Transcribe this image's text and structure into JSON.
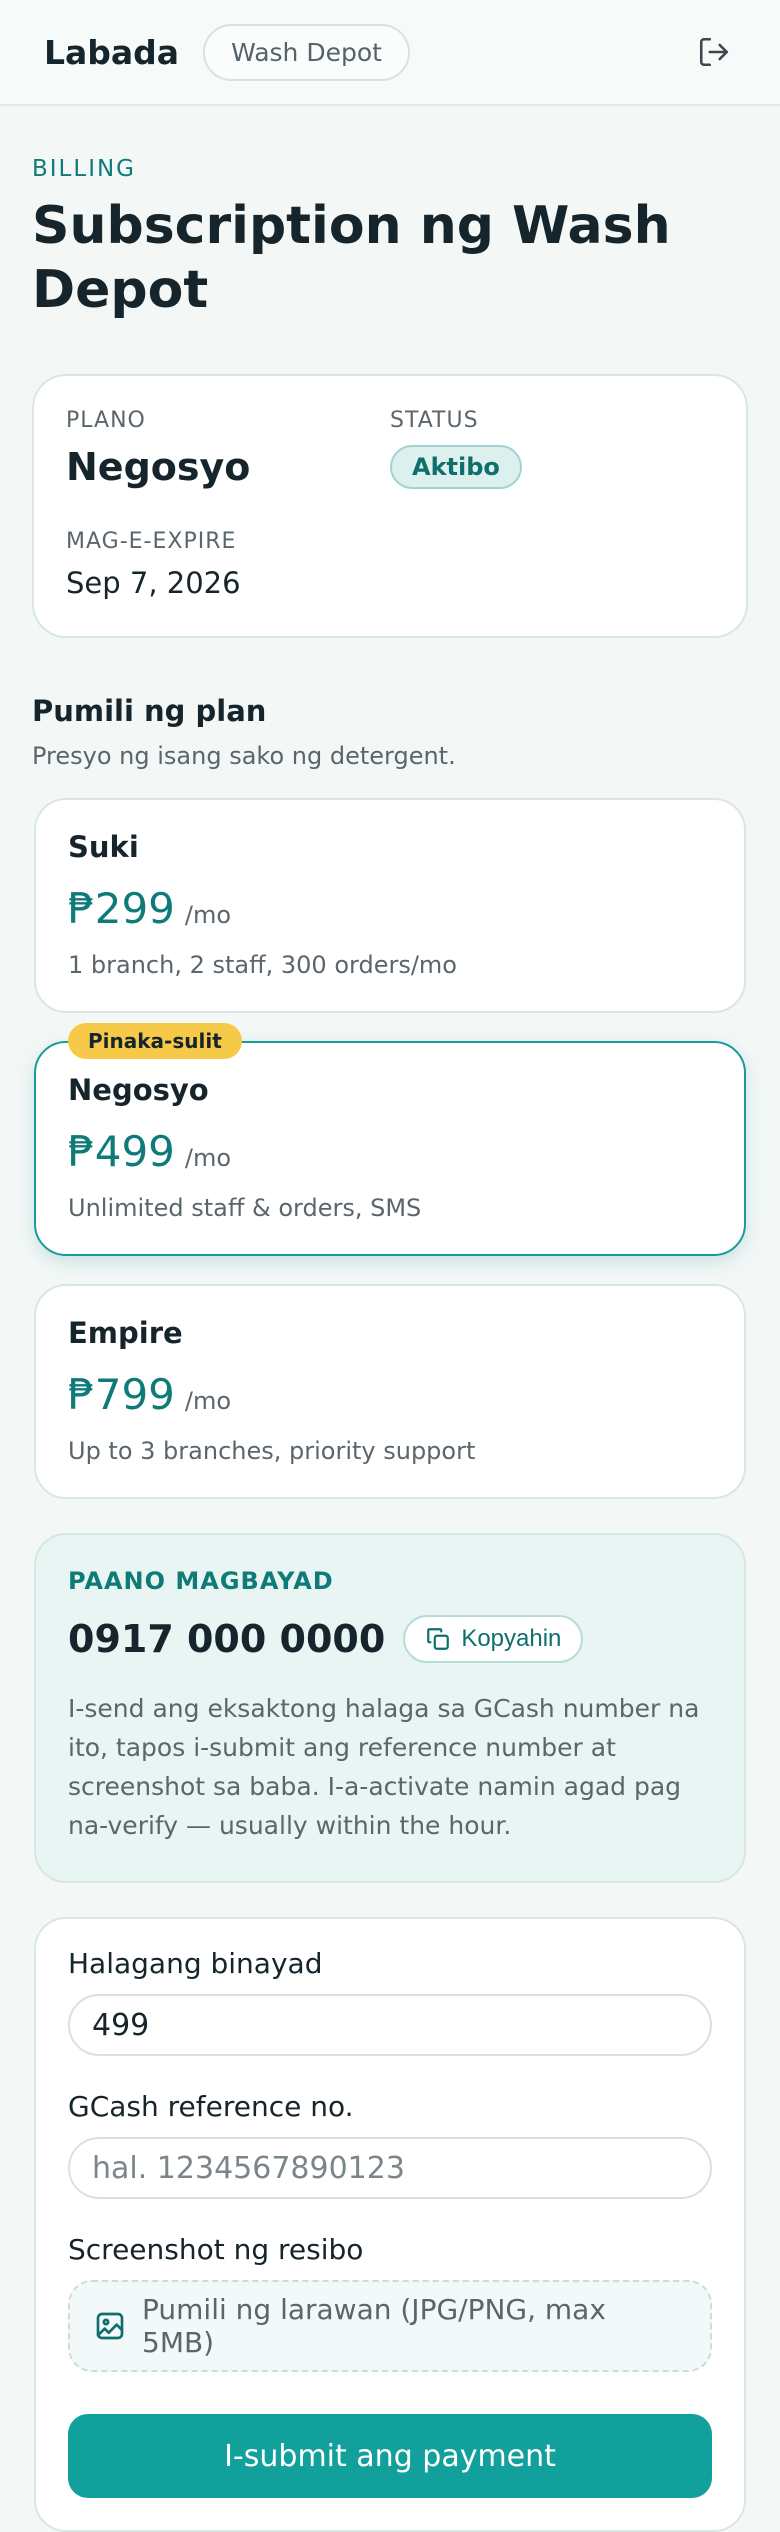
{
  "header": {
    "brand": "Labada",
    "shop_name": "Wash Depot",
    "logout_icon": "logout-icon"
  },
  "page": {
    "eyebrow": "BILLING",
    "title": "Subscription ng Wash Depot"
  },
  "summary": {
    "plan_label": "PLANO",
    "plan_value": "Negosyo",
    "status_label": "STATUS",
    "status_value": "Aktibo",
    "expire_label": "MAG-E-EXPIRE",
    "expire_value": "Sep 7, 2026"
  },
  "plans_section": {
    "title": "Pumili ng plan",
    "subtitle": "Presyo ng isang sako ng detergent.",
    "plans": [
      {
        "name": "Suki",
        "price": "₱299",
        "per": "/mo",
        "desc": "1 branch, 2 staff, 300 orders/mo"
      },
      {
        "name": "Negosyo",
        "price": "₱499",
        "per": "/mo",
        "desc": "Unlimited staff & orders, SMS",
        "badge": "Pinaka-sulit"
      },
      {
        "name": "Empire",
        "price": "₱799",
        "per": "/mo",
        "desc": "Up to 3 branches, priority support"
      }
    ]
  },
  "payment": {
    "eyebrow": "PAANO MAGBAYAD",
    "gcash_number": "0917 000 0000",
    "copy_label": "Kopyahin",
    "instructions": "I-send ang eksaktong halaga sa GCash number na ito, tapos i-submit ang reference number at screenshot sa baba. I-a-activate namin agad pag na-verify — usually within the hour."
  },
  "form": {
    "amount_label": "Halagang binayad",
    "amount_value": "499",
    "reference_label": "GCash reference no.",
    "reference_placeholder": "hal. 1234567890123",
    "screenshot_label": "Screenshot ng resibo",
    "upload_text": "Pumili ng larawan (JPG/PNG, max 5MB)",
    "submit_label": "I-submit ang payment"
  },
  "colors": {
    "accent": "#0f7b78",
    "button": "#11a09b",
    "badge": "#f7c948"
  }
}
